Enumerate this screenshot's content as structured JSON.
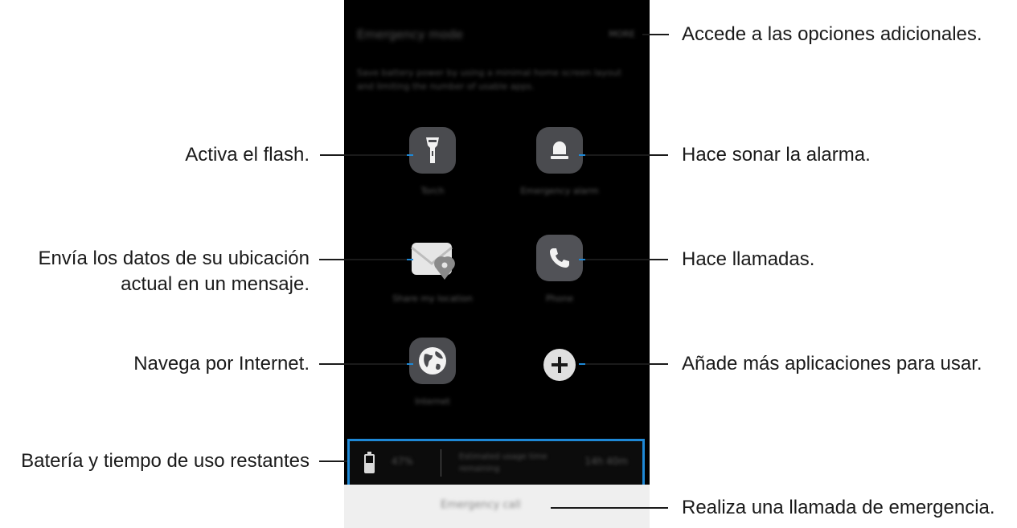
{
  "phone": {
    "header_title": "Emergency mode",
    "more_label": "MORE",
    "description": "Save battery power by using a minimal home screen layout and limiting the number of usable apps.",
    "apps": [
      {
        "label": "Torch",
        "icon": "flashlight-icon"
      },
      {
        "label": "Emergency alarm",
        "icon": "alarm-bell-icon"
      },
      {
        "label": "Share my location",
        "icon": "envelope-location-icon"
      },
      {
        "label": "Phone",
        "icon": "phone-handset-icon"
      },
      {
        "label": "Internet",
        "icon": "globe-icon"
      },
      {
        "label": "",
        "icon": "plus-icon"
      }
    ],
    "battery": {
      "percent": "47%",
      "usage_label": "Estimated usage time remaining",
      "time": "14h 40m"
    },
    "emergency_call_label": "Emergency call"
  },
  "callouts": {
    "more_options": "Accede a las opciones adicionales.",
    "torch": "Activa el flash.",
    "alarm": "Hace sonar la alarma.",
    "share_location_line1": "Envía los datos de su ubicación",
    "share_location_line2": "actual en un mensaje.",
    "phone": "Hace llamadas.",
    "internet": "Navega por Internet.",
    "add_apps": "Añade más aplicaciones para usar.",
    "battery": "Batería y tiempo de uso restantes",
    "emergency_call": "Realiza una llamada de emergencia."
  },
  "colors": {
    "highlight_blue": "#1e88d6",
    "screen_background": "#000000",
    "app_icon_background": "#4a4b4f"
  }
}
